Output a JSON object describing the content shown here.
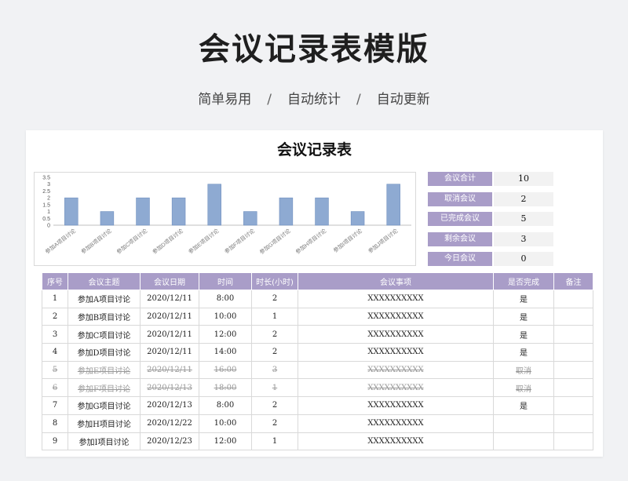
{
  "header": {
    "title": "会议记录表模版",
    "tagline_1": "简单易用",
    "tagline_2": "自动统计",
    "tagline_3": "自动更新",
    "separator": "/"
  },
  "sheet": {
    "title": "会议记录表"
  },
  "summary": [
    {
      "label": "会议合计",
      "value": "10"
    },
    {
      "label": "取消会议",
      "value": "2"
    },
    {
      "label": "已完成会议",
      "value": "5"
    },
    {
      "label": "剩余会议",
      "value": "3"
    },
    {
      "label": "今日会议",
      "value": "0"
    }
  ],
  "chart_data": {
    "type": "bar",
    "categories": [
      "参加A项目讨论",
      "参加B项目讨论",
      "参加C项目讨论",
      "参加D项目讨论",
      "参加E项目讨论",
      "参加F项目讨论",
      "参加G项目讨论",
      "参加H项目讨论",
      "参加I项目讨论",
      "参加J项目讨论"
    ],
    "values": [
      2,
      1,
      2,
      2,
      3,
      1,
      2,
      2,
      1,
      3
    ],
    "yticks": [
      "3.5",
      "3",
      "2.5",
      "2",
      "1.5",
      "1",
      "0.5",
      "0"
    ],
    "ylim": [
      0,
      3.5
    ],
    "grid": false,
    "bar_color": "#8eaad2"
  },
  "table": {
    "columns": [
      "序号",
      "会议主题",
      "会议日期",
      "时间",
      "时长(小时)",
      "会议事项",
      "是否完成",
      "备注"
    ],
    "rows": [
      {
        "no": "1",
        "topic": "参加A项目讨论",
        "date": "2020/12/11",
        "time": "8:00",
        "hours": "2",
        "item": "XXXXXXXXXX",
        "done": "是",
        "note": "",
        "cancelled": false
      },
      {
        "no": "2",
        "topic": "参加B项目讨论",
        "date": "2020/12/11",
        "time": "10:00",
        "hours": "1",
        "item": "XXXXXXXXXX",
        "done": "是",
        "note": "",
        "cancelled": false
      },
      {
        "no": "3",
        "topic": "参加C项目讨论",
        "date": "2020/12/11",
        "time": "12:00",
        "hours": "2",
        "item": "XXXXXXXXXX",
        "done": "是",
        "note": "",
        "cancelled": false
      },
      {
        "no": "4",
        "topic": "参加D项目讨论",
        "date": "2020/12/11",
        "time": "14:00",
        "hours": "2",
        "item": "XXXXXXXXXX",
        "done": "是",
        "note": "",
        "cancelled": false
      },
      {
        "no": "5",
        "topic": "参加E项目讨论",
        "date": "2020/12/11",
        "time": "16:00",
        "hours": "3",
        "item": "XXXXXXXXXX",
        "done": "取消",
        "note": "",
        "cancelled": true
      },
      {
        "no": "6",
        "topic": "参加F项目讨论",
        "date": "2020/12/13",
        "time": "18:00",
        "hours": "1",
        "item": "XXXXXXXXXX",
        "done": "取消",
        "note": "",
        "cancelled": true
      },
      {
        "no": "7",
        "topic": "参加G项目讨论",
        "date": "2020/12/13",
        "time": "8:00",
        "hours": "2",
        "item": "XXXXXXXXXX",
        "done": "是",
        "note": "",
        "cancelled": false
      },
      {
        "no": "8",
        "topic": "参加H项目讨论",
        "date": "2020/12/22",
        "time": "10:00",
        "hours": "2",
        "item": "XXXXXXXXXX",
        "done": "",
        "note": "",
        "cancelled": false
      },
      {
        "no": "9",
        "topic": "参加I项目讨论",
        "date": "2020/12/23",
        "time": "12:00",
        "hours": "1",
        "item": "XXXXXXXXXX",
        "done": "",
        "note": "",
        "cancelled": false
      }
    ]
  }
}
